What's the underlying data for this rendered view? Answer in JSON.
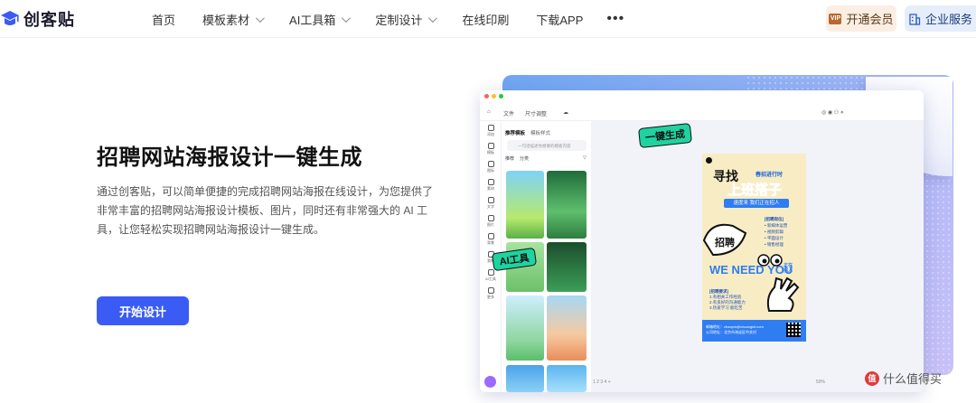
{
  "brand": {
    "name": "创客贴"
  },
  "nav": {
    "items": [
      {
        "label": "首页",
        "dropdown": false
      },
      {
        "label": "模板素材",
        "dropdown": true
      },
      {
        "label": "AI工具箱",
        "dropdown": true
      },
      {
        "label": "定制设计",
        "dropdown": true
      },
      {
        "label": "在线印刷",
        "dropdown": false
      },
      {
        "label": "下载APP",
        "dropdown": false
      }
    ],
    "more": "•••",
    "vip_label": "开通会员",
    "vip_badge": "VIP",
    "enterprise_label": "企业服务"
  },
  "hero": {
    "title": "招聘网站海报设计一键生成",
    "description": "通过创客贴，可以简单便捷的完成招聘网站海报在线设计，为您提供了非常丰富的招聘网站海报设计模板、图片，同时还有非常强大的 AI 工具，让您轻松实现招聘网站海报设计一键生成。",
    "cta": "开始设计"
  },
  "editor": {
    "toolbar": [
      "文件",
      "尺寸调整"
    ],
    "sidebar": [
      "添加",
      "模板",
      "图标",
      "素材",
      "文字",
      "图片",
      "背景",
      "我的",
      "AI工具",
      "更多"
    ],
    "panel_tabs": [
      "推荐模板",
      "模板样式"
    ],
    "search_placeholder": "一句话描述你想要的模板内容",
    "filter": [
      "推荐",
      "分类"
    ],
    "zoom": "50%",
    "pages": "1 2 3 4 +"
  },
  "stickers": {
    "one_click": "一键生成",
    "ai_tool": "AI工具"
  },
  "poster": {
    "header": "招聘进行时",
    "find": "寻找",
    "hot": "春招进行时",
    "main": "上班搭子",
    "bar": "速度来 我们正在招人",
    "recruit": "招聘",
    "positions_title": "[招聘岗位]",
    "positions": [
      "• 新媒体运营",
      "• 视频剪辑",
      "• 平面设计",
      "• 销售经理"
    ],
    "need": "WE NEED YOU",
    "stamp": "正在招人",
    "requirements_title": "[招聘要求]",
    "requirements": [
      "1.有相关工作经验",
      "2.有良好的沟通能力",
      "3.热爱学习 能吃苦"
    ],
    "footer": [
      "邮箱地址：zhaopin@chuangkit.com",
      "公司地址：北京市海淀区中关村"
    ]
  },
  "watermark": {
    "label": "什么值得买",
    "icon": "值"
  },
  "colors": {
    "primary": "#3a5cf5",
    "vip_bg": "#fbeee3",
    "enterprise_bg": "#e6eefb",
    "sticker": "#1ed3a0"
  }
}
